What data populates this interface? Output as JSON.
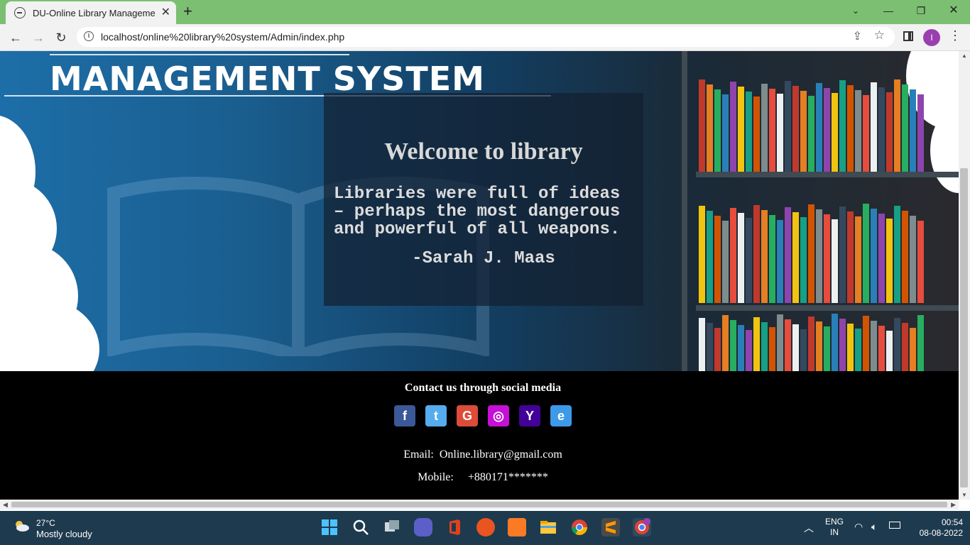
{
  "browser": {
    "tab_title": "DU-Online Library Management",
    "new_tab": "+",
    "url": "localhost/online%20library%20system/Admin/index.php",
    "profile_initial": "I",
    "window_controls": [
      "chevron-down-icon",
      "minimize-icon",
      "restore-icon",
      "close-icon"
    ]
  },
  "hero": {
    "logo_text": "MANAGEMENT SYSTEM",
    "welcome_title": "Welcome to library",
    "quote": "Libraries were full of ideas – perhaps the most dangerous and powerful of all weapons.",
    "author": "-Sarah J. Maas"
  },
  "footer": {
    "heading": "Contact us through social media",
    "socials": [
      {
        "name": "facebook",
        "glyph": "f",
        "color": "#3b5998"
      },
      {
        "name": "twitter",
        "glyph": "t",
        "color": "#55acee"
      },
      {
        "name": "google",
        "glyph": "G",
        "color": "#dd4b39"
      },
      {
        "name": "instagram",
        "glyph": "◎",
        "color": "#c510d6"
      },
      {
        "name": "yahoo",
        "glyph": "Y",
        "color": "#430297"
      },
      {
        "name": "internet-explorer",
        "glyph": "e",
        "color": "#3d9ae8"
      }
    ],
    "email_label": "Email:",
    "email_value": "Online.library@gmail.com",
    "mobile_label": "Mobile:",
    "mobile_value": "+880171*******"
  },
  "taskbar": {
    "temperature": "27°C",
    "weather": "Mostly cloudy",
    "lang_1": "ENG",
    "lang_2": "IN",
    "time": "00:54",
    "date": "08-08-2022"
  }
}
